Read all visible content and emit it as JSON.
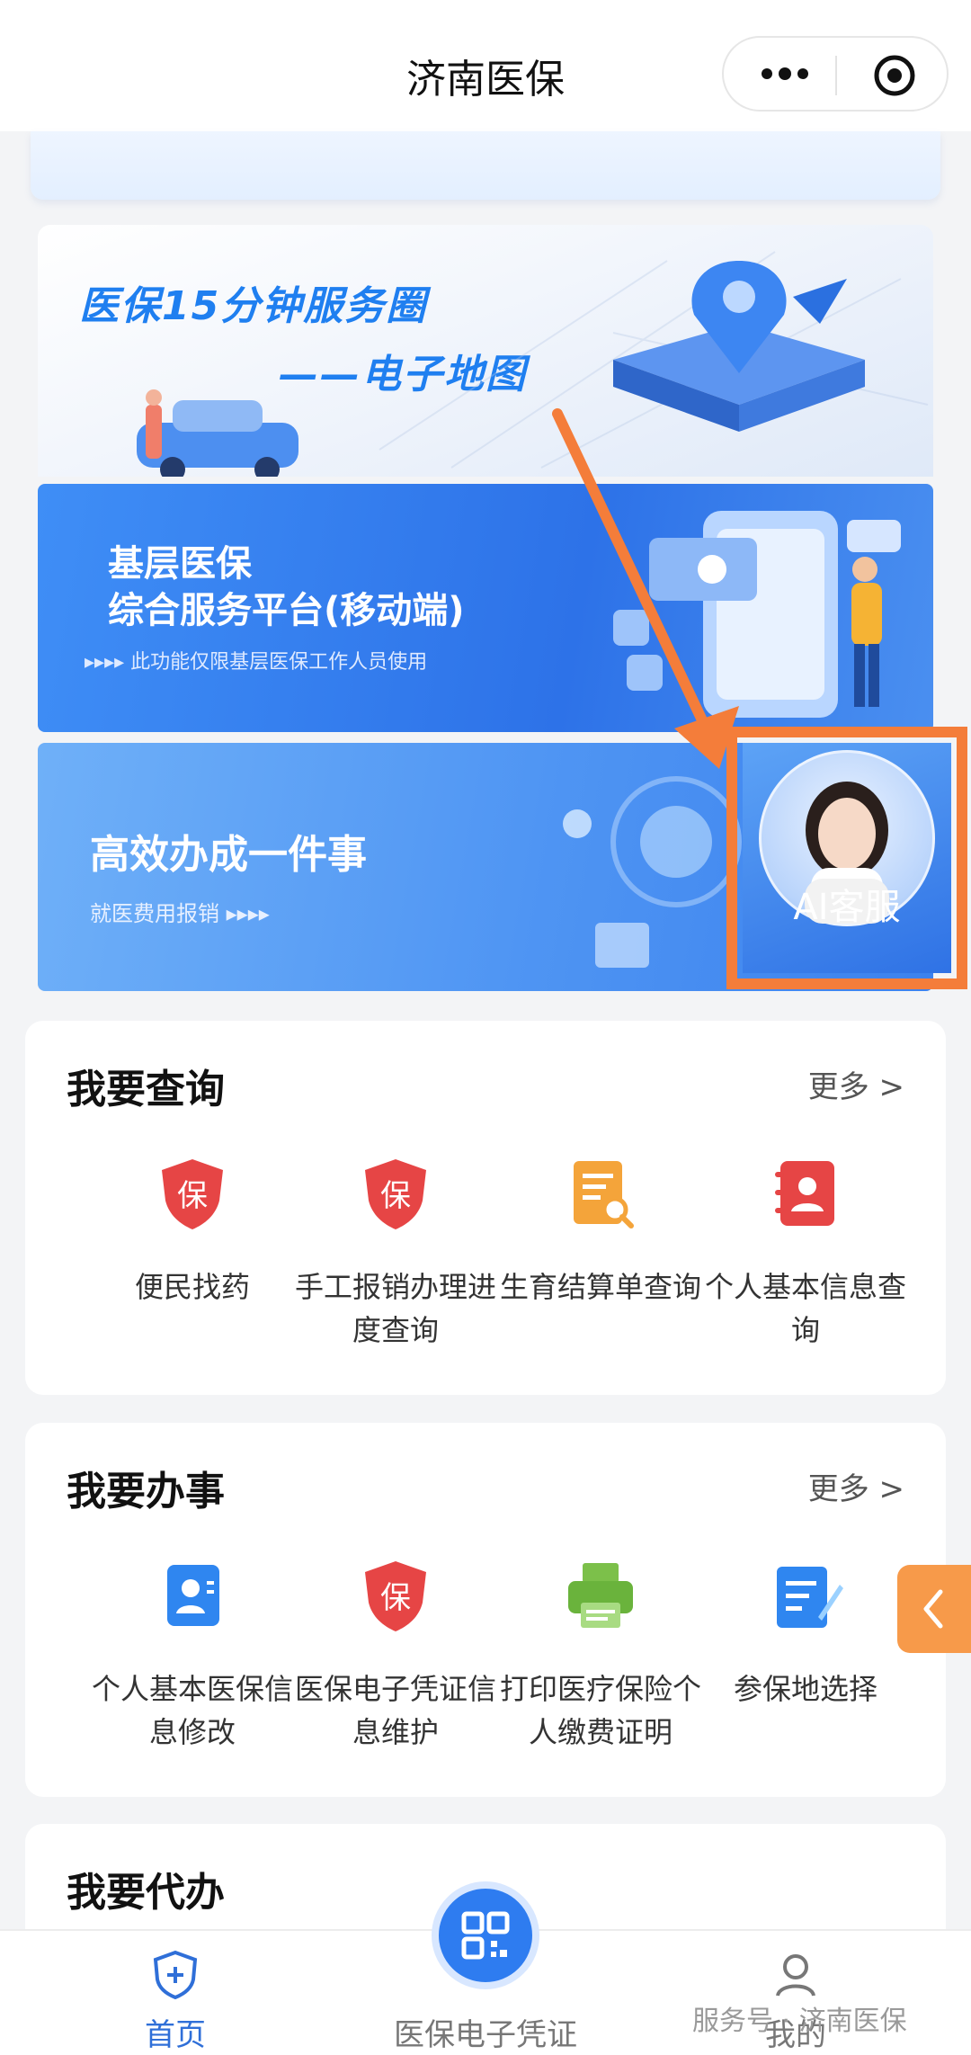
{
  "nav": {
    "title": "济南医保"
  },
  "banners": {
    "map": {
      "line1": "医保15分钟服务圈",
      "line2": "——电子地图"
    },
    "platform": {
      "line1": "基层医保",
      "line2": "综合服务平台(移动端)",
      "note": "▸▸▸▸ 此功能仅限基层医保工作人员使用"
    },
    "efficient": {
      "title": "高效办成一件事",
      "sub": "就医费用报销 ▸▸▸▸"
    },
    "ai": {
      "label": "AI客服"
    }
  },
  "query": {
    "title": "我要查询",
    "more": "更多 >",
    "items": [
      {
        "label": "便民找药",
        "icon": "shield-bao-icon"
      },
      {
        "label": "手工报销办理进度查询",
        "icon": "shield-bao-icon"
      },
      {
        "label": "生育结算单查询",
        "icon": "document-search-icon"
      },
      {
        "label": "个人基本信息查询",
        "icon": "contact-book-icon"
      }
    ]
  },
  "work": {
    "title": "我要办事",
    "more": "更多 >",
    "items": [
      {
        "label": "个人基本医保信息修改",
        "icon": "id-card-icon"
      },
      {
        "label": "医保电子凭证信息维护",
        "icon": "shield-bao-icon"
      },
      {
        "label": "打印医疗保险个人缴费证明",
        "icon": "printer-icon"
      },
      {
        "label": "参保地选择",
        "icon": "edit-document-icon"
      }
    ]
  },
  "agent": {
    "title": "我要代办"
  },
  "tabbar": {
    "home": "首页",
    "card": "医保电子凭证",
    "mine": "我的"
  },
  "watermark": "服务号 · 济南医保",
  "colors": {
    "accent": "#2e7cf0",
    "highlight": "#f47d3a",
    "red": "#e64545"
  }
}
